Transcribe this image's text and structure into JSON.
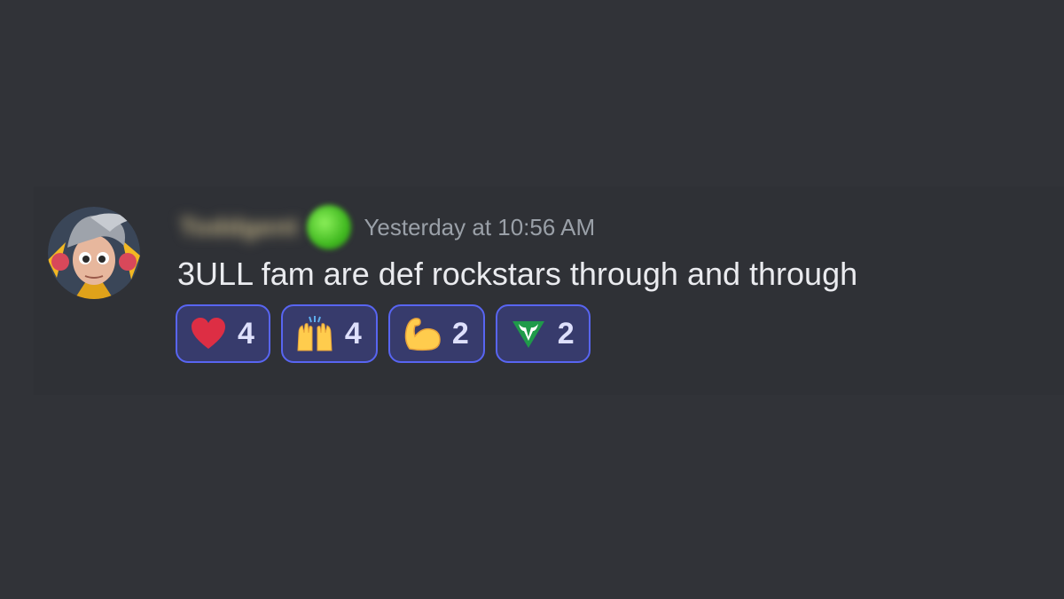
{
  "message": {
    "username": "Toddgent",
    "timestamp": "Yesterday at 10:56 AM",
    "content": "3ULL fam are def rockstars through and through"
  },
  "reactions": [
    {
      "icon": "heart-icon",
      "count": "4"
    },
    {
      "icon": "raised-hands-icon",
      "count": "4"
    },
    {
      "icon": "flexed-biceps-icon",
      "count": "2"
    },
    {
      "icon": "bull-emblem-icon",
      "count": "2"
    }
  ],
  "colors": {
    "background": "#313338",
    "reaction_border": "#5865f2",
    "reaction_fill": "#373b6c",
    "timestamp": "#9aa0a8",
    "text": "#eaebef"
  }
}
